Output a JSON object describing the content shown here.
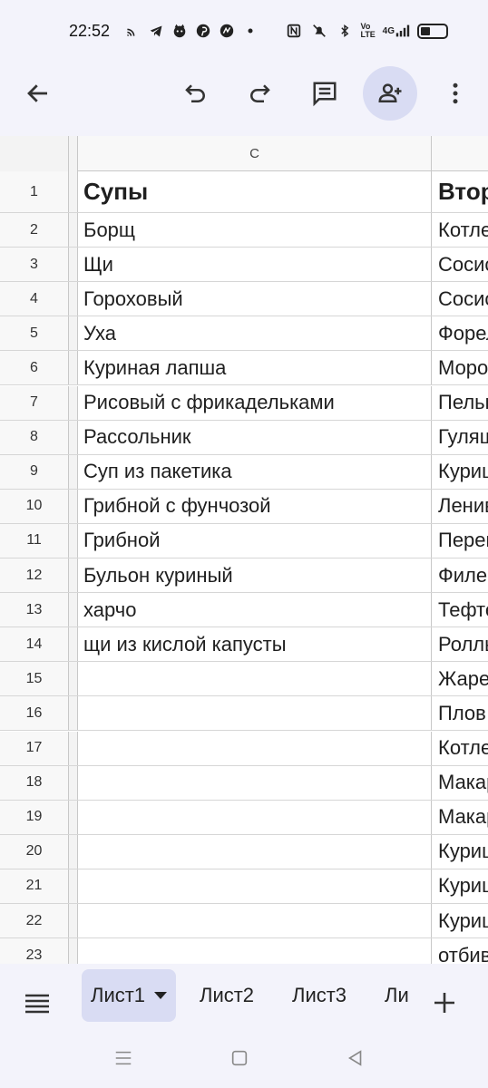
{
  "status": {
    "time": "22:52",
    "network": "4G"
  },
  "sheet": {
    "column_header": "C",
    "rows": [
      {
        "n": "1",
        "c": "Супы",
        "d": "Вторые"
      },
      {
        "n": "2",
        "c": "Борщ",
        "d": "Котлеты"
      },
      {
        "n": "3",
        "c": "Щи",
        "d": "Сосиски"
      },
      {
        "n": "4",
        "c": "Гороховый",
        "d": "Сосиски"
      },
      {
        "n": "5",
        "c": "Уха",
        "d": "Форель"
      },
      {
        "n": "6",
        "c": "Куриная лапша",
        "d": "Морож"
      },
      {
        "n": "7",
        "c": "Рисовый с фрикадельками",
        "d": "Пельмени"
      },
      {
        "n": "8",
        "c": "Рассольник",
        "d": "Гуляш"
      },
      {
        "n": "9",
        "c": "Суп из пакетика",
        "d": "Курица"
      },
      {
        "n": "10",
        "c": "Грибной с фунчозой",
        "d": "Ленивые"
      },
      {
        "n": "11",
        "c": "Грибной",
        "d": "Перец"
      },
      {
        "n": "12",
        "c": "Бульон куриный",
        "d": "Филе"
      },
      {
        "n": "13",
        "c": "харчо",
        "d": "Тефтели"
      },
      {
        "n": "14",
        "c": "щи из кислой капусты",
        "d": "Роллы"
      },
      {
        "n": "15",
        "c": "",
        "d": "Жареная"
      },
      {
        "n": "16",
        "c": "",
        "d": "Плов"
      },
      {
        "n": "17",
        "c": "",
        "d": "Котлеты"
      },
      {
        "n": "18",
        "c": "",
        "d": "Макароны"
      },
      {
        "n": "19",
        "c": "",
        "d": "Макароны"
      },
      {
        "n": "20",
        "c": "",
        "d": "Курица"
      },
      {
        "n": "21",
        "c": "",
        "d": "Курица"
      },
      {
        "n": "22",
        "c": "",
        "d": "Курица"
      },
      {
        "n": "23",
        "c": "",
        "d": "отбивные"
      }
    ]
  },
  "tabs": [
    {
      "label": "Лист1",
      "active": true
    },
    {
      "label": "Лист2",
      "active": false
    },
    {
      "label": "Лист3",
      "active": false
    },
    {
      "label": "Ли",
      "active": false
    }
  ]
}
